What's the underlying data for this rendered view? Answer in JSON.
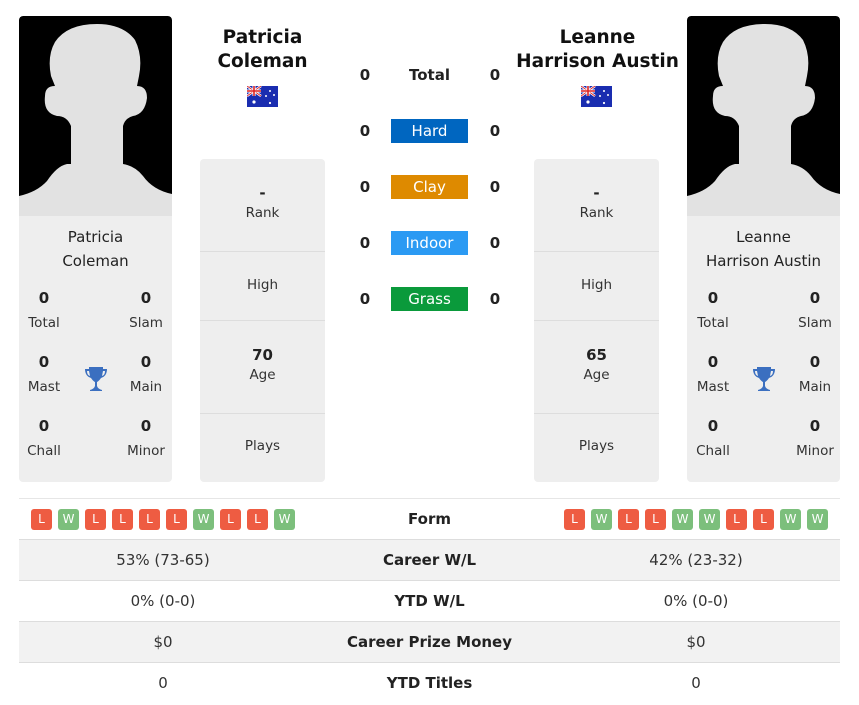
{
  "players": [
    {
      "name": "Patricia Coleman",
      "header_name_line1": "Patricia",
      "header_name_line2": "Coleman",
      "card_name_line1": "Patricia",
      "card_name_line2": "Coleman",
      "country": "Australia",
      "flag_icon": "australia-flag-icon",
      "titles": {
        "total": {
          "value": "0",
          "label": "Total"
        },
        "slam": {
          "value": "0",
          "label": "Slam"
        },
        "mast": {
          "value": "0",
          "label": "Mast"
        },
        "main": {
          "value": "0",
          "label": "Main"
        },
        "chall": {
          "value": "0",
          "label": "Chall"
        },
        "minor": {
          "value": "0",
          "label": "Minor"
        }
      },
      "info": {
        "rank": {
          "value": "-",
          "label": "Rank"
        },
        "high": {
          "value": "",
          "label": "High"
        },
        "age": {
          "value": "70",
          "label": "Age"
        },
        "plays": {
          "value": "",
          "label": "Plays"
        }
      },
      "form": [
        "L",
        "W",
        "L",
        "L",
        "L",
        "L",
        "W",
        "L",
        "L",
        "W"
      ],
      "career_wl": "53% (73-65)",
      "ytd_wl": "0% (0-0)",
      "career_prize": "$0",
      "ytd_titles": "0"
    },
    {
      "name": "Leanne Harrison Austin",
      "header_name_line1": "Leanne",
      "header_name_line2": "Harrison Austin",
      "card_name_line1": "Leanne",
      "card_name_line2": "Harrison Austin",
      "country": "Australia",
      "flag_icon": "australia-flag-icon",
      "titles": {
        "total": {
          "value": "0",
          "label": "Total"
        },
        "slam": {
          "value": "0",
          "label": "Slam"
        },
        "mast": {
          "value": "0",
          "label": "Mast"
        },
        "main": {
          "value": "0",
          "label": "Main"
        },
        "chall": {
          "value": "0",
          "label": "Chall"
        },
        "minor": {
          "value": "0",
          "label": "Minor"
        }
      },
      "info": {
        "rank": {
          "value": "-",
          "label": "Rank"
        },
        "high": {
          "value": "",
          "label": "High"
        },
        "age": {
          "value": "65",
          "label": "Age"
        },
        "plays": {
          "value": "",
          "label": "Plays"
        }
      },
      "form": [
        "L",
        "W",
        "L",
        "L",
        "W",
        "W",
        "L",
        "L",
        "W",
        "W"
      ],
      "career_wl": "42% (23-32)",
      "ytd_wl": "0% (0-0)",
      "career_prize": "$0",
      "ytd_titles": "0"
    }
  ],
  "h2h": {
    "rows": [
      {
        "label": "Total",
        "left": "0",
        "right": "0",
        "color": ""
      },
      {
        "label": "Hard",
        "left": "0",
        "right": "0",
        "color": "#0066c0"
      },
      {
        "label": "Clay",
        "left": "0",
        "right": "0",
        "color": "#de8a00"
      },
      {
        "label": "Indoor",
        "left": "0",
        "right": "0",
        "color": "#2b9af3"
      },
      {
        "label": "Grass",
        "left": "0",
        "right": "0",
        "color": "#0a9a3b"
      }
    ]
  },
  "stats_labels": {
    "form": "Form",
    "career_wl": "Career W/L",
    "ytd_wl": "YTD W/L",
    "career_prize": "Career Prize Money",
    "ytd_titles": "YTD Titles"
  },
  "colors": {
    "loss": "#ee5c42",
    "win": "#7cbf7c",
    "trophy": "#3b6fc0"
  }
}
